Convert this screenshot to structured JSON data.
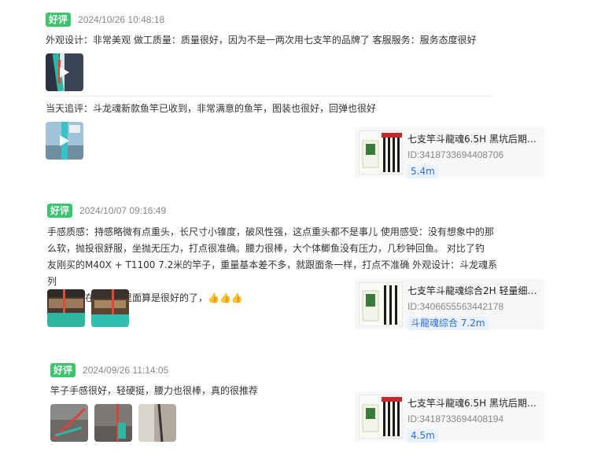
{
  "reviews": [
    {
      "badge": "好评",
      "date": "2024/10/26 10:48:18",
      "text": "外观设计：非常美观 做工质量：质量很好，因为不是一两次用七支竿的品牌了 客服服务：服务态度很好",
      "followup_text": "当天追评：斗龙魂新款鱼竿已收到，非常满意的鱼竿，图装也很好，回弹也很好",
      "product": {
        "title": "七支竿斗龍魂6.5H 黑坑后期…",
        "id": "ID:3418733694408706",
        "spec": "5.4m"
      }
    },
    {
      "badge": "好评",
      "date": "2024/10/07 09:16:49",
      "lines": [
        "手感质感：持感略微有点重头，长尺寸小锥度，破风性强，这点重头都不是事儿 使用感受：没有想象中的那",
        "么软，抛投很舒服，坐抛无压力，打点很准确。腰力很棒，大个体鲫鱼没有压力，几秒钟回鱼。  对比了钓",
        "友刚买的M40X + T1100 7.2米的竿子，重量基本差不多，就跟面条一样，打点不准确 外观设计：斗龙魂系列",
        "的涂装，在七支竿里面算是很好的了，"
      ],
      "emoji": "👍👍👍",
      "product": {
        "title": "七支竿斗龍魂综合2H 轻量细…",
        "id": "ID:3406655563442178",
        "spec": "斗龍魂综合 7.2m"
      }
    },
    {
      "badge": "好评",
      "date": "2024/09/26 11:14:05",
      "text": "竿子手感很好，轻硬挺，腰力也很棒，真的很推荐",
      "product": {
        "title": "七支竿斗龍魂6.5H 黑坑后期…",
        "id": "ID:3418733694408194",
        "spec": "4.5m"
      }
    }
  ]
}
